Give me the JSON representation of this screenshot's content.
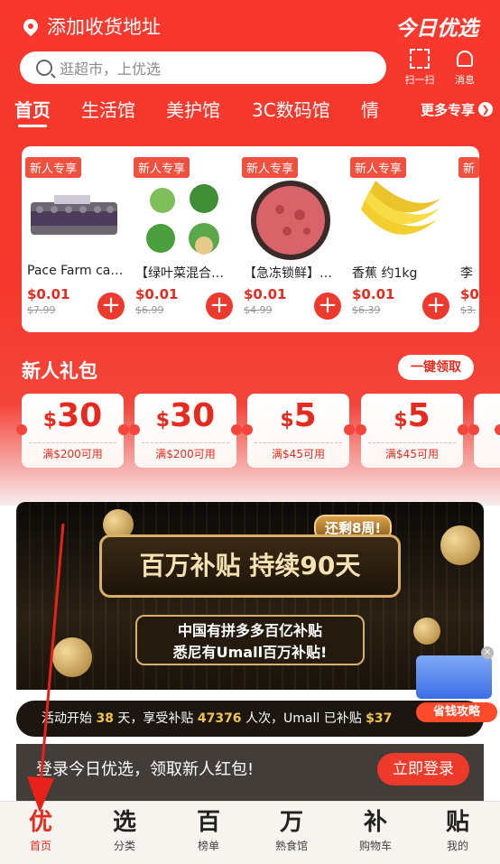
{
  "header": {
    "address": "添加收货地址",
    "brand": "今日优选"
  },
  "search": {
    "placeholder": "逛超市，上优选",
    "scan_label": "扫一扫",
    "message_label": "消息"
  },
  "tabs": [
    "首页",
    "生活馆",
    "美护馆",
    "3C数码馆",
    "情"
  ],
  "more_label": "更多专享",
  "products": [
    {
      "tag": "新人专享",
      "name": "Pace Farm cag…",
      "price": "$0.01",
      "orig": "$7.99"
    },
    {
      "tag": "新人专享",
      "name": "【绿叶菜混合…",
      "price": "$0.01",
      "orig": "$6.99"
    },
    {
      "tag": "新人专享",
      "name": "【急冻锁鲜】…",
      "price": "$0.01",
      "orig": "$4.99"
    },
    {
      "tag": "新人专享",
      "name": "香蕉 约1kg",
      "price": "$0.01",
      "orig": "$6.39"
    },
    {
      "tag": "新",
      "name": "李",
      "price": "$0",
      "orig": "$3."
    }
  ],
  "gift": {
    "title": "新人礼包",
    "claim": "一键领取",
    "coupons": [
      {
        "amount": "30",
        "cond": "满$200可用"
      },
      {
        "amount": "30",
        "cond": "满$200可用"
      },
      {
        "amount": "5",
        "cond": "满$45可用"
      },
      {
        "amount": "5",
        "cond": "满$45可用"
      }
    ]
  },
  "banner": {
    "badge": "还剩8周!",
    "title": "百万补贴 持续90天",
    "sub_line1": "中国有拼多多百亿补贴",
    "sub_line2": "悉尼有Umall百万补贴!"
  },
  "stats": {
    "prefix": "活动开始",
    "days": "38",
    "mid": "天，享受补贴",
    "count": "47376",
    "suffix": "人次，Umall 已补贴",
    "amount": "$37"
  },
  "promo": {
    "label": "省钱攻略",
    "close": "×"
  },
  "login": {
    "text": "登录今日优选，领取新人红包!",
    "button": "立即登录"
  },
  "nav": [
    {
      "icon": "优",
      "label": "首页"
    },
    {
      "icon": "选",
      "label": "分类"
    },
    {
      "icon": "百",
      "label": "榜单"
    },
    {
      "icon": "万",
      "label": "熟食馆"
    },
    {
      "icon": "补",
      "label": "购物车"
    },
    {
      "icon": "贴",
      "label": "我的"
    }
  ],
  "colors": {
    "primary_red": "#f5372c",
    "price_red": "#e52b1f",
    "gold": "#d9b06a"
  }
}
